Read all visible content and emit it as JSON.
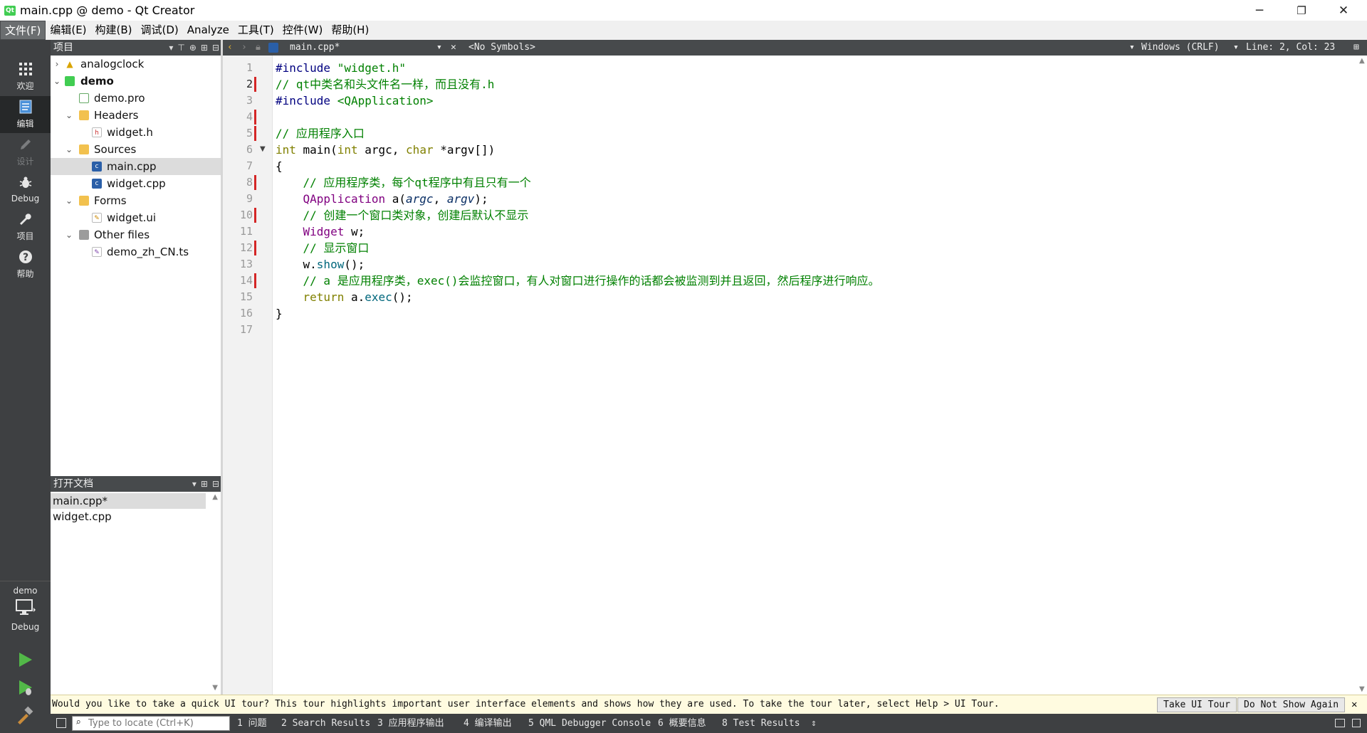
{
  "window": {
    "title": "main.cpp @ demo - Qt Creator",
    "app_icon_text": "Qt",
    "minimize": "─",
    "restore": "❐",
    "close": "✕"
  },
  "menu": [
    "文件(F)",
    "编辑(E)",
    "构建(B)",
    "调试(D)",
    "Analyze",
    "工具(T)",
    "控件(W)",
    "帮助(H)"
  ],
  "modes": {
    "welcome": "欢迎",
    "edit": "编辑",
    "design": "设计",
    "debug": "Debug",
    "projects": "项目",
    "help": "帮助",
    "kit_project": "demo",
    "kit_build": "Debug"
  },
  "project_panel": {
    "title": "项目",
    "tree": [
      {
        "label": "analogclock"
      },
      {
        "label": "demo"
      },
      {
        "label": "demo.pro"
      },
      {
        "label": "Headers"
      },
      {
        "label": "widget.h"
      },
      {
        "label": "Sources"
      },
      {
        "label": "main.cpp"
      },
      {
        "label": "widget.cpp"
      },
      {
        "label": "Forms"
      },
      {
        "label": "widget.ui"
      },
      {
        "label": "Other files"
      },
      {
        "label": "demo_zh_CN.ts"
      }
    ]
  },
  "open_docs": {
    "title": "打开文档",
    "items": [
      "main.cpp*",
      "widget.cpp"
    ]
  },
  "editor_toolbar": {
    "file": "main.cpp*",
    "symbols": "<No Symbols>",
    "line_ending": "Windows (CRLF)",
    "position": "Line: 2, Col: 23"
  },
  "code": {
    "line_numbers": [
      "1",
      "2",
      "3",
      "4",
      "5",
      "6",
      "7",
      "8",
      "9",
      "10",
      "11",
      "12",
      "13",
      "14",
      "15",
      "16",
      "17"
    ],
    "changed_lines": [
      2,
      4,
      5,
      8,
      10,
      12,
      14
    ],
    "current_line": 2,
    "lines": [
      [
        {
          "t": "#include ",
          "c": "k-pre"
        },
        {
          "t": "\"widget.h\"",
          "c": "k-str"
        }
      ],
      [
        {
          "t": "// qt中类名和头文件名一样，而且没有.h",
          "c": "k-cmt"
        }
      ],
      [
        {
          "t": "#include ",
          "c": "k-pre"
        },
        {
          "t": "<QApplication>",
          "c": "k-str"
        }
      ],
      [],
      [
        {
          "t": "// 应用程序入口",
          "c": "k-cmt"
        }
      ],
      [
        {
          "t": "int",
          "c": "k-type"
        },
        {
          "t": " main(",
          "c": "k-plain"
        },
        {
          "t": "int",
          "c": "k-type"
        },
        {
          "t": " argc, ",
          "c": "k-plain"
        },
        {
          "t": "char",
          "c": "k-type"
        },
        {
          "t": " *argv[])",
          "c": "k-plain"
        }
      ],
      [
        {
          "t": "{",
          "c": "k-plain"
        }
      ],
      [
        {
          "t": "    // 应用程序类，每个qt程序中有且只有一个",
          "c": "k-cmt"
        }
      ],
      [
        {
          "t": "    ",
          "c": "k-plain"
        },
        {
          "t": "QApplication",
          "c": "k-cls"
        },
        {
          "t": " a(",
          "c": "k-plain"
        },
        {
          "t": "argc",
          "c": "k-var"
        },
        {
          "t": ", ",
          "c": "k-plain"
        },
        {
          "t": "argv",
          "c": "k-var"
        },
        {
          "t": ");",
          "c": "k-plain"
        }
      ],
      [
        {
          "t": "    // 创建一个窗口类对象，创建后默认不显示",
          "c": "k-cmt"
        }
      ],
      [
        {
          "t": "    ",
          "c": "k-plain"
        },
        {
          "t": "Widget",
          "c": "k-cls"
        },
        {
          "t": " w;",
          "c": "k-plain"
        }
      ],
      [
        {
          "t": "    // 显示窗口",
          "c": "k-cmt"
        }
      ],
      [
        {
          "t": "    w.",
          "c": "k-plain"
        },
        {
          "t": "show",
          "c": "k-fn"
        },
        {
          "t": "();",
          "c": "k-plain"
        }
      ],
      [
        {
          "t": "    // a 是应用程序类，exec()会监控窗口，有人对窗口进行操作的话都会被监测到并且返回，然后程序进行响应。",
          "c": "k-cmt"
        }
      ],
      [
        {
          "t": "    ",
          "c": "k-plain"
        },
        {
          "t": "return",
          "c": "k-type"
        },
        {
          "t": " a.",
          "c": "k-plain"
        },
        {
          "t": "exec",
          "c": "k-fn"
        },
        {
          "t": "();",
          "c": "k-plain"
        }
      ],
      [
        {
          "t": "}",
          "c": "k-plain"
        }
      ],
      []
    ]
  },
  "tour": {
    "message": "Would you like to take a quick UI tour? This tour highlights important user interface elements and shows how they are used. To take the tour later, select Help > UI Tour.",
    "take_label": "Take UI Tour",
    "dismiss_label": "Do Not Show Again"
  },
  "statusbar": {
    "locator_placeholder": "Type to locate (Ctrl+K)",
    "tabs": [
      "1 问题",
      "2 Search Results",
      "3 应用程序输出",
      "4 编译输出",
      "5 QML Debugger Console",
      "6 概要信息",
      "8 Test Results"
    ]
  },
  "colors": {
    "sidebar_bg": "#3e4042",
    "panel_header_bg": "#474a4c",
    "change_marker": "#d42626",
    "tour_bg": "#fffbe0"
  }
}
